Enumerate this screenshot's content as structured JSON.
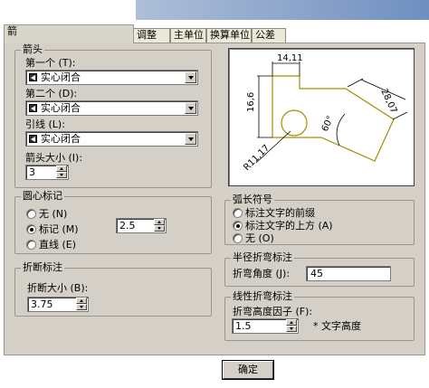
{
  "tabs": [
    {
      "label": "箭",
      "active": true
    },
    {
      "label": "调整"
    },
    {
      "label": "主单位"
    },
    {
      "label": "换算单位"
    },
    {
      "label": "公差"
    }
  ],
  "arrows": {
    "legend": "箭头",
    "first_label": "第一个 (T):",
    "first_value": "实心闭合",
    "second_label": "第二个 (D):",
    "second_value": "实心闭合",
    "leader_label": "引线 (L):",
    "leader_value": "实心闭合",
    "size_label": "箭头大小 (I):",
    "size_value": "3"
  },
  "center_marks": {
    "legend": "圆心标记",
    "options": [
      "无 (N)",
      "标记 (M)",
      "直线 (E)"
    ],
    "selected": 1,
    "size_value": "2.5"
  },
  "break": {
    "legend": "折断标注",
    "size_label": "折断大小 (B):",
    "size_value": "3.75"
  },
  "arc_length": {
    "legend": "弧长符号",
    "options": [
      "标注文字的前缀",
      "标注文字的上方 (A)",
      "无 (O)"
    ],
    "selected": 1
  },
  "radius_jog": {
    "legend": "半径折弯标注",
    "angle_label": "折弯角度 (J):",
    "angle_value": "45"
  },
  "linear_jog": {
    "legend": "线性折弯标注",
    "factor_label": "折弯高度因子 (F):",
    "factor_value": "1.5",
    "unit_text": "* 文字高度"
  },
  "preview": {
    "dim_top": "14,11",
    "dim_left": "16,6",
    "dim_right": "28,07",
    "dim_radius": "R11,17",
    "dim_angle": "60°"
  },
  "buttons": {
    "ok_label": "确定"
  },
  "colors": {
    "panel": "#d4d0c8",
    "preview_line": "#a09000"
  }
}
